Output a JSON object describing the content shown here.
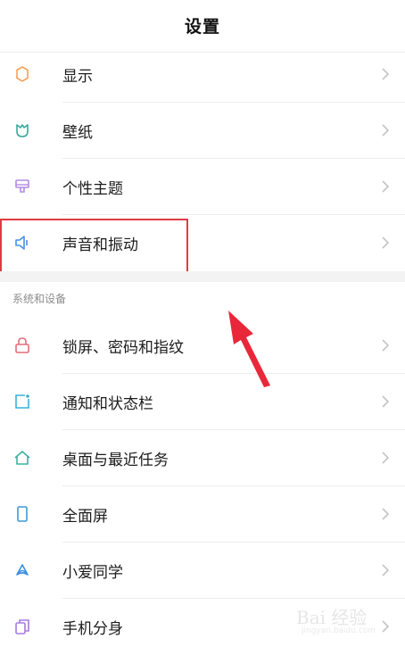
{
  "header": {
    "title": "设置"
  },
  "group1": [
    {
      "label": "显示",
      "icon": "sun-icon",
      "color": "#f4a259"
    },
    {
      "label": "壁纸",
      "icon": "tulip-icon",
      "color": "#3aa89b"
    },
    {
      "label": "个性主题",
      "icon": "brush-icon",
      "color": "#b48be6"
    },
    {
      "label": "声音和振动",
      "icon": "speaker-icon",
      "color": "#4a90e2"
    }
  ],
  "section": {
    "title": "系统和设备"
  },
  "group2": [
    {
      "label": "锁屏、密码和指纹",
      "icon": "lock-icon",
      "color": "#e36d7a"
    },
    {
      "label": "通知和状态栏",
      "icon": "notification-icon",
      "color": "#3ab0d9"
    },
    {
      "label": "桌面与最近任务",
      "icon": "home-icon",
      "color": "#38b4a0"
    },
    {
      "label": "全面屏",
      "icon": "phone-icon",
      "color": "#3c9ad6"
    },
    {
      "label": "小爱同学",
      "icon": "assistant-icon",
      "color": "#3c8fe0"
    },
    {
      "label": "手机分身",
      "icon": "dual-phone-icon",
      "color": "#a67be0"
    }
  ],
  "watermark": {
    "main": "Bai 经验",
    "sub": "jingyan.baidu.com"
  },
  "colors": {
    "highlight": "#e03a44",
    "arrow": "#e8283a"
  }
}
